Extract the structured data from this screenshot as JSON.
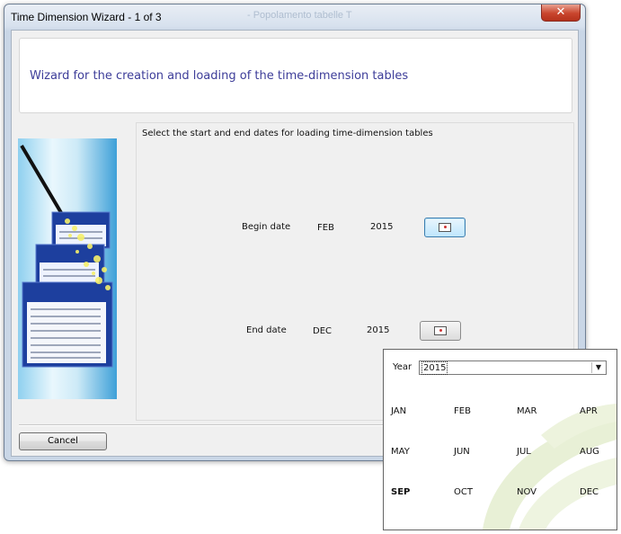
{
  "window": {
    "title": "Time Dimension Wizard - 1 of 3",
    "background_title": "- Popolamento tabelle T",
    "close_glyph": "✕"
  },
  "header": {
    "title": "Wizard for the creation and loading of the time-dimension tables"
  },
  "content": {
    "instruction": "Select the start and end dates for loading time-dimension tables",
    "begin": {
      "label": "Begin date",
      "month": "FEB",
      "year": "2015",
      "button_icon": "calendar-icon"
    },
    "end": {
      "label": "End date",
      "month": "DEC",
      "year": "2015",
      "button_icon": "calendar-icon"
    }
  },
  "footer": {
    "cancel_label": "Cancel"
  },
  "picker": {
    "year_label": "Year",
    "year_value": "2015",
    "dropdown_icon": "chevron-down-icon",
    "selected_month": "SEP",
    "months": [
      "JAN",
      "FEB",
      "MAR",
      "APR",
      "MAY",
      "JUN",
      "JUL",
      "AUG",
      "SEP",
      "OCT",
      "NOV",
      "DEC"
    ]
  },
  "colors": {
    "title_accent": "#3d3d99",
    "close_button": "#c9452d",
    "focus_border": "#3c7fb1",
    "popup_watermark": "#e3eccd"
  }
}
